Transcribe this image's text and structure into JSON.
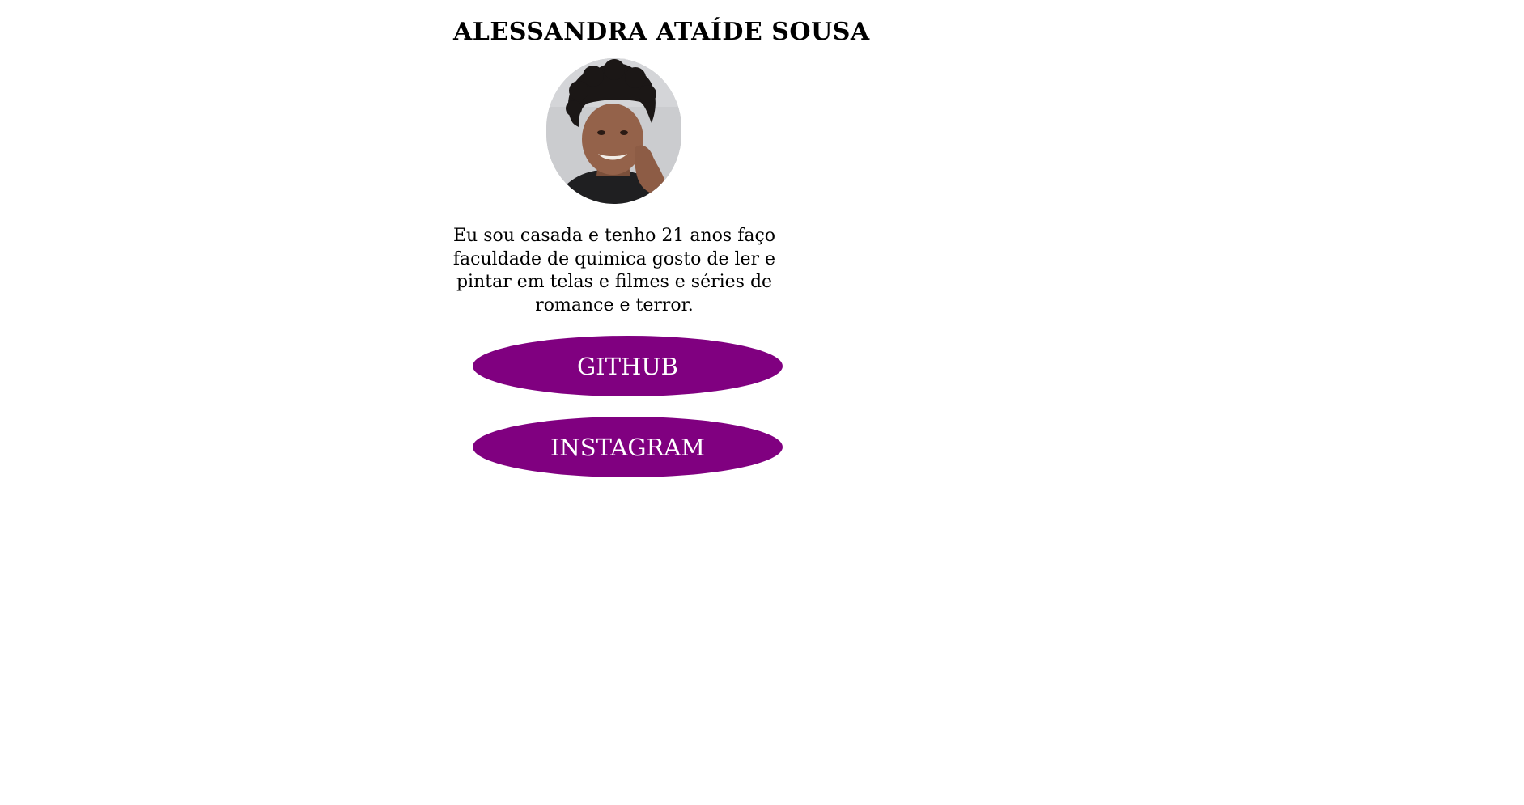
{
  "profile": {
    "name": "ALESSANDRA ATAÍDE SOUSA",
    "bio": "Eu sou casada e tenho 21 anos faço faculdade de quimica gosto de ler e pintar em telas e filmes e séries de romance e terror."
  },
  "links": {
    "github_label": "GITHUB",
    "instagram_label": "INSTAGRAM"
  },
  "colors": {
    "button_background": "#800080",
    "button_text": "#ffffff",
    "page_background": "#ffffff"
  }
}
